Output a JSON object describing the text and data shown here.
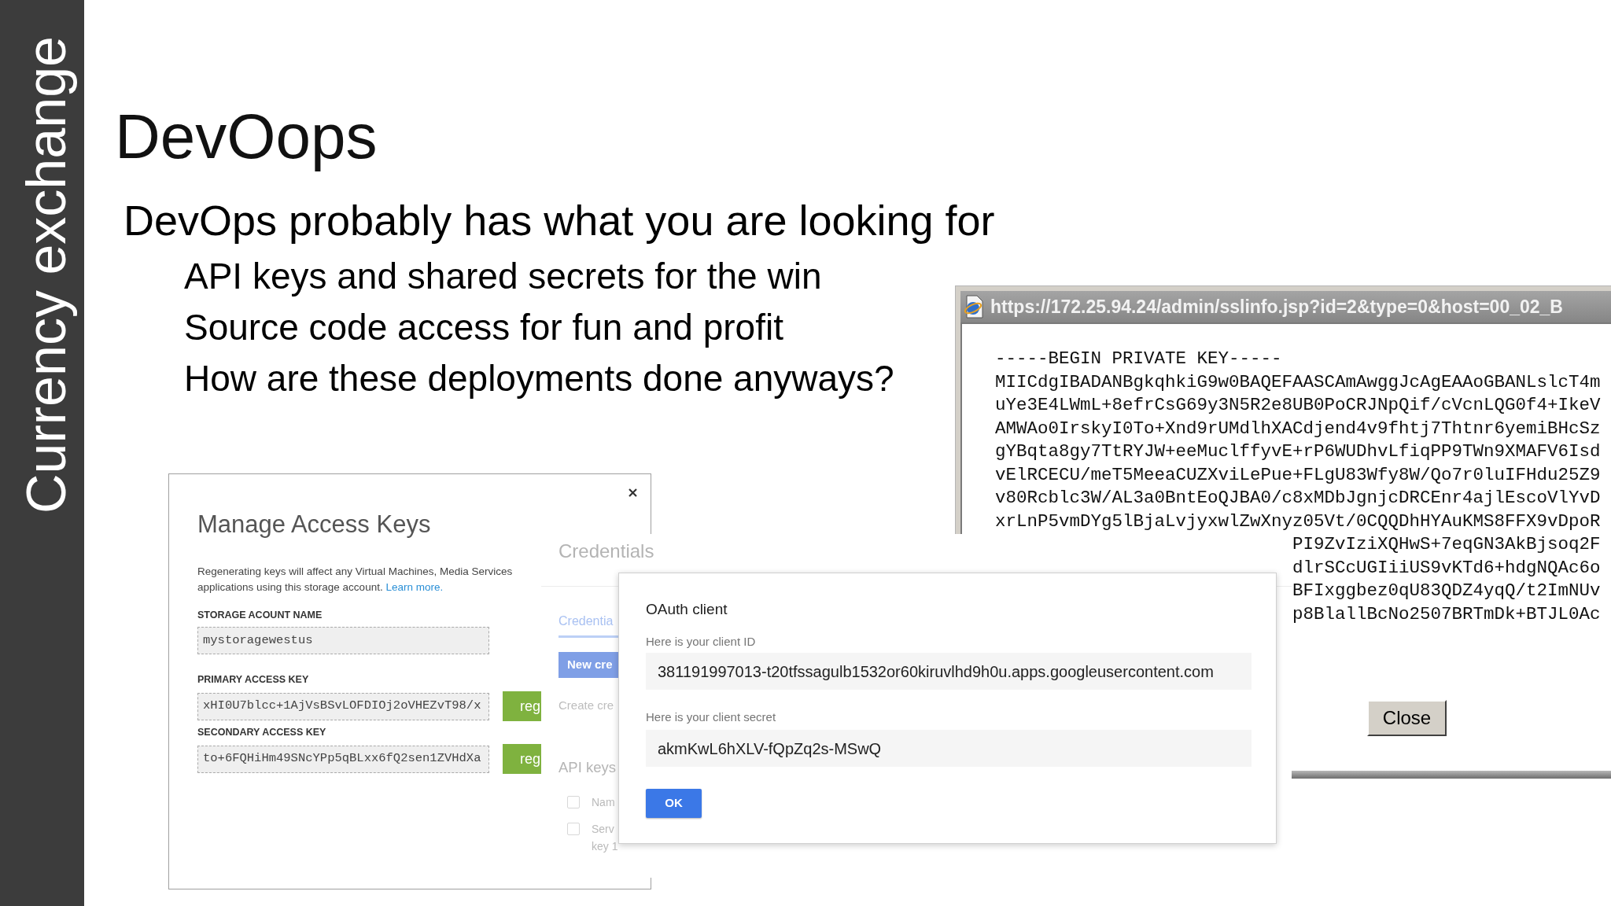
{
  "sidebar": {
    "title": "Currency exchange"
  },
  "slide": {
    "title": "DevOops",
    "bullets": [
      {
        "text": "DevOps probably has what you are looking for",
        "children": [
          {
            "text": "API keys and shared secrets for the win"
          },
          {
            "text": "Source code access for fun and profit"
          },
          {
            "text": "How are these deployments done anyways?"
          }
        ]
      }
    ]
  },
  "private_key_window": {
    "title": "https://172.25.94.24/admin/sslinfo.jsp?id=2&type=0&host=00_02_B",
    "lines": [
      "-----BEGIN PRIVATE KEY-----",
      "MIICdgIBADANBgkqhkiG9w0BAQEFAASCAmAwggJcAgEAAoGBANLslcT4m",
      "uYe3E4LWmL+8efrCsG69y3N5R2e8UB0PoCRJNpQif/cVcnLQG0f4+IkeV",
      "AMWAo0IrskyI0To+Xnd9rUMdlhXACdjend4v9fhtj7Thtnr6yemiBHcSz",
      "gYBqta8gy7TtRYJW+eeMuclffyvE+rP6WUDhvLfiqPP9TWn9XMAFV6Isd",
      "vElRCECU/meT5MeeaCUZXviLePue+FLgU83Wfy8W/Qo7r0luIFHdu25Z9",
      "v80Rcblc3W/AL3a0BntEoQJBA0/c8xMDbJgnjcDRCEnr4ajlEscoVlYvD",
      "xrLnP5vmDYg5lBjaLvjyxwlZwXnyz05Vt/0CQQDhHYAuKMS8FFX9vDpoR"
    ],
    "partial_lines": [
      "PI9ZvIziXQHwS+7eqGN3AkBjsoq2F",
      "dlrSCcUGIiiUS9vKTd6+hdgNQAc6o",
      "BFIxggbez0qU83QDZ4yqQ/t2ImNUv",
      "p8BlallBcNo2507BRTmDk+BTJL0Ac"
    ],
    "close_button": "Close"
  },
  "manage_access_keys": {
    "title": "Manage Access Keys",
    "notice": {
      "lines": [
        "Regenerating keys will affect any Virtual Machines, Media Services",
        "applications using this storage account."
      ],
      "link": "Learn more."
    },
    "fields": [
      {
        "label": "STORAGE ACOUNT NAME",
        "value": "mystoragewestus"
      },
      {
        "label": "PRIMARY ACCESS KEY",
        "value": "xHI0U7blcc+1AjVsBSvLOFDIOj2oVHEZvT98/x",
        "button": "reg"
      },
      {
        "label": "SECONDARY ACCESS KEY",
        "value": "to+6FQHiHm49SNcYPp5qBLxx6fQ2sen1ZVHdXa",
        "button": "reg"
      }
    ]
  },
  "credentials": {
    "title": "Credentials",
    "tabs": [
      {
        "label": "Credentia",
        "selected": true
      }
    ],
    "new_button": "New cre",
    "create_text": "Create cre",
    "section_title": "API keys",
    "rows": [
      {
        "checked": false,
        "lines": [
          "Nam"
        ]
      },
      {
        "checked": false,
        "lines": [
          "Serv",
          "key 1"
        ]
      }
    ]
  },
  "oauth_client": {
    "title": "OAuth client",
    "fields": [
      {
        "label": "Here is your client ID",
        "value": "381191997013-t20tfssagulb1532or60kiruvlhd9h0u.apps.googleusercontent.com"
      },
      {
        "label": "Here is your client secret",
        "value": "akmKwL6hXLV-fQpZq2s-MSwQ"
      }
    ],
    "ok_button": "OK"
  }
}
